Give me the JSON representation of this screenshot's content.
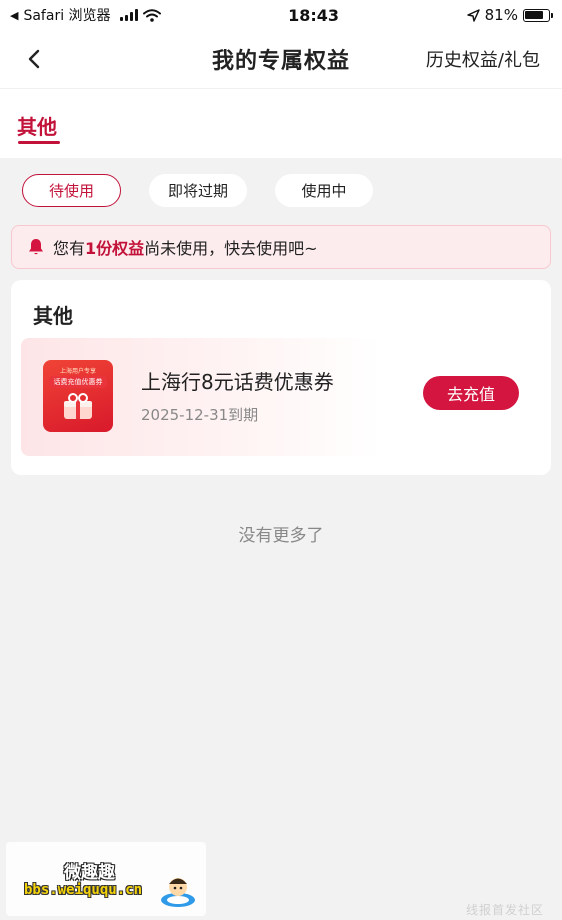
{
  "status_bar": {
    "back_app": "Safari 浏览器",
    "time": "18:43",
    "battery": "81%"
  },
  "nav": {
    "title": "我的专属权益",
    "right_link": "历史权益/礼包"
  },
  "tabs": [
    {
      "label": "其他",
      "active": true
    }
  ],
  "filters": [
    {
      "label": "待使用",
      "active": true
    },
    {
      "label": "即将过期",
      "active": false
    },
    {
      "label": "使用中",
      "active": false
    }
  ],
  "notice": {
    "prefix": "您有",
    "highlight": "1份权益",
    "suffix": "尚未使用，快去使用吧~"
  },
  "card": {
    "title": "其他",
    "coupon": {
      "thumb_line1": "上海用户专享",
      "thumb_line2": "话费充值优惠券",
      "name": "上海行8元话费优惠券",
      "expiry": "2025-12-31到期",
      "action": "去充值"
    }
  },
  "footer": {
    "no_more": "没有更多了"
  },
  "watermark": {
    "name": "微趣趣",
    "url": "bbs.weiququ.cn",
    "corner": "线报首发社区"
  },
  "colors": {
    "accent": "#c2123a",
    "button": "#d3153f",
    "page_bg": "#f2f2f2"
  }
}
